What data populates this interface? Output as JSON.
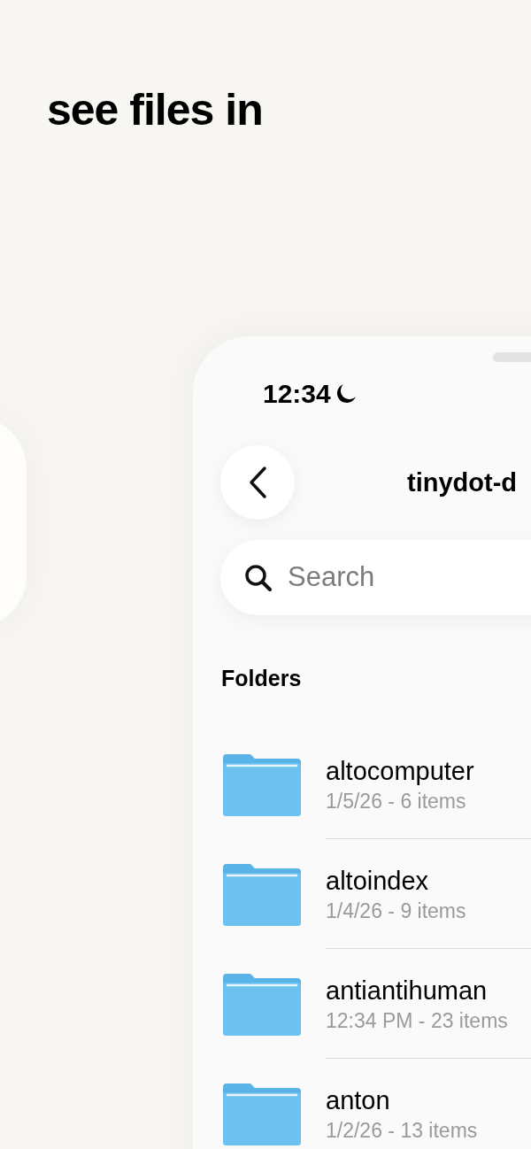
{
  "headline": "see files in",
  "status_bar": {
    "time": "12:34"
  },
  "nav": {
    "title": "tinydot-d"
  },
  "search": {
    "placeholder": "Search"
  },
  "section_title": "Folders",
  "folders": [
    {
      "name": "altocomputer",
      "detail": "1/5/26 - 6 items"
    },
    {
      "name": "altoindex",
      "detail": "1/4/26 - 9 items"
    },
    {
      "name": "antiantihuman",
      "detail": "12:34 PM - 23 items"
    },
    {
      "name": "anton",
      "detail": "1/2/26 - 13 items"
    }
  ]
}
